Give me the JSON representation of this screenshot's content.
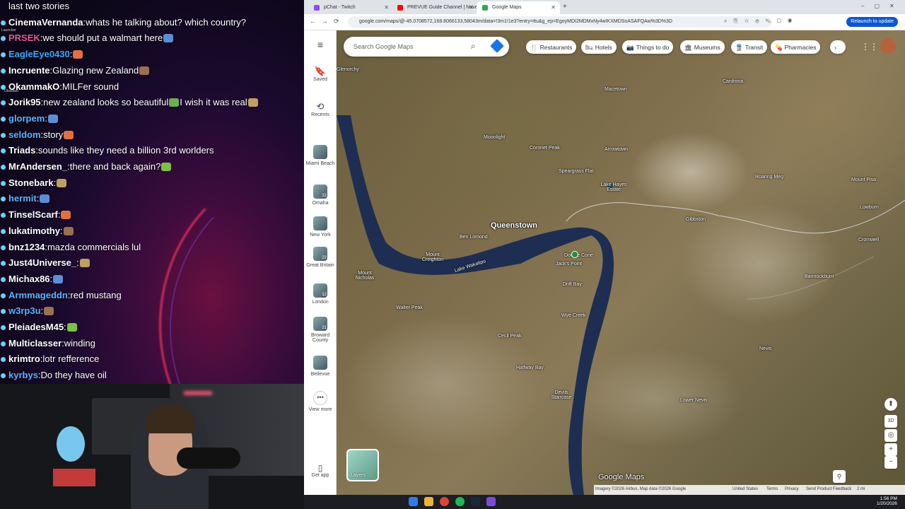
{
  "chat": {
    "messages": [
      {
        "user": "",
        "text": "last two stories",
        "color": "#ffffff"
      },
      {
        "user": "CinemaVernanda",
        "text": "whats he talking about? which country?",
        "color": "#ffffff"
      },
      {
        "user": "PRSEK",
        "text": "we should put a walmart here",
        "color": "#e05a9a"
      },
      {
        "user": "EagleEye0430",
        "text": "",
        "color": "#3da8ff"
      },
      {
        "user": "Incruente",
        "text": "Glazing new Zealand",
        "color": "#ffffff"
      },
      {
        "user": "OkammakO",
        "text": "MILFer sound",
        "color": "#ffffff"
      },
      {
        "user": "Jorik95",
        "text": "new zealand looks so beautiful",
        "text2": "I wish it was real",
        "color": "#ffffff"
      },
      {
        "user": "glorpem",
        "text": "",
        "color": "#5cb3ff"
      },
      {
        "user": "seldom",
        "text": "story",
        "color": "#5cb3ff"
      },
      {
        "user": "Triads",
        "text": "sounds like they need a billion 3rd worlders",
        "color": "#ffffff"
      },
      {
        "user": "MrAndersen_",
        "text": "there and back again?",
        "color": "#ffffff"
      },
      {
        "user": "Stonebark",
        "text": "",
        "color": "#ffffff"
      },
      {
        "user": "hermit",
        "text": "",
        "color": "#5cb3ff"
      },
      {
        "user": "TinselScarf",
        "text": "",
        "color": "#ffffff"
      },
      {
        "user": "lukatimothy",
        "text": "",
        "color": "#ffffff"
      },
      {
        "user": "bnz1234",
        "text": "mazda commercials lul",
        "color": "#ffffff"
      },
      {
        "user": "Just4Universe_",
        "text": "",
        "color": "#ffffff"
      },
      {
        "user": "Michax86",
        "text": "",
        "color": "#ffffff"
      },
      {
        "user": "Armmageddn",
        "text": "red mustang",
        "color": "#5cb3ff"
      },
      {
        "user": "w3rp3u",
        "text": "",
        "color": "#5cb3ff"
      },
      {
        "user": "PleiadesM45",
        "text": "",
        "color": "#ffffff"
      },
      {
        "user": "Multiclasser",
        "text": "winding",
        "color": "#ffffff"
      },
      {
        "user": "krimtro",
        "text": "lotr refference",
        "color": "#ffffff"
      },
      {
        "user": "kyrbys",
        "text": "Do they have oil",
        "color": "#5cb3ff"
      }
    ],
    "sidebar_labels": [
      "Launcher",
      "Obsidian"
    ]
  },
  "browser": {
    "tabs": [
      {
        "label": "pChat - Twitch",
        "color": "#9146ff"
      },
      {
        "label": "PREVUE Guide Channel | Novem...",
        "color": "#ff0000"
      },
      {
        "label": "Google Maps",
        "color": "#34a853"
      }
    ],
    "url": "google.com/maps/@-45.0708572,168.8066133,58043m/data=!3m1!1e3?entry=ttu&g_ep=EgoyMDI2MDMxNy4wIKXMDSoASAFQAw%3D%3D",
    "relaunch": "Relaunch to update"
  },
  "maps": {
    "search_placeholder": "Search Google Maps",
    "chips": [
      {
        "icon": "restaurant-icon",
        "glyph": "🍴",
        "label": "Restaurants"
      },
      {
        "icon": "hotel-icon",
        "glyph": "🛏",
        "label": "Hotels"
      },
      {
        "icon": "camera-icon",
        "glyph": "📷",
        "label": "Things to do"
      },
      {
        "icon": "museum-icon",
        "glyph": "🏛",
        "label": "Museums"
      },
      {
        "icon": "transit-icon",
        "glyph": "🚆",
        "label": "Transit"
      },
      {
        "icon": "pharmacy-icon",
        "glyph": "💊",
        "label": "Pharmacies"
      }
    ],
    "rail": {
      "saved": "Saved",
      "recents": "Recents",
      "places": [
        {
          "label": "Miami Beach",
          "badge": ""
        },
        {
          "label": "Omaha",
          "badge": "12"
        },
        {
          "label": "New York",
          "badge": ""
        },
        {
          "label": "Great Britain",
          "badge": "22"
        },
        {
          "label": "London",
          "badge": "12"
        },
        {
          "label": "Broward County",
          "badge": "21"
        },
        {
          "label": "Bellevue",
          "badge": ""
        }
      ],
      "view_more": "View more",
      "get_app": "Get app"
    },
    "labels": {
      "queenstown": "Queenstown",
      "macetown": "Macetown",
      "arrowtown": "Arrowtown",
      "moonlight": "Moonlight",
      "coronet_peak": "Coronet Peak",
      "speargrass_flat": "Speargrass Flat",
      "lake_hayes_estate": "Lake Hayes Estate",
      "ben_lomond": "Ben Lomond",
      "mount_creighton": "Mount Creighton",
      "lake_wakatipu": "Lake Wakatipu",
      "mount_nicholas": "Mount Nicholas",
      "walter_peak": "Walter Peak",
      "cecil_peak": "Cecil Peak",
      "halfway_bay": "Halfway Bay",
      "devils_staircase": "Devils Staircase",
      "wye_creek": "Wye Creek",
      "drift_bay": "Drift Bay",
      "jacks_point": "Jack's Point",
      "double_cone": "Double Cone",
      "gibbston": "Gibbston",
      "roaring_meg": "Roaring Meg",
      "cardrona": "Cardrona",
      "mount_pisa": "Mount Pisa",
      "lowburn": "Lowburn",
      "cromwell": "Cromwell",
      "bannockburn": "Bannockburn",
      "nevis": "Nevis",
      "lower_nevis": "Lower Nevis",
      "glenorchy": "Glenorchy",
      "layers": "Layers",
      "watermark": "Google Maps"
    },
    "footer": {
      "attribution": "Imagery ©2026 Airbus, Map data ©2026 Google",
      "united_states": "United States",
      "terms": "Terms",
      "privacy": "Privacy",
      "feedback": "Send Product Feedback",
      "scale": "2 mi"
    }
  },
  "taskbar": {
    "time": "1:56 PM",
    "date": "1/20/2026"
  }
}
